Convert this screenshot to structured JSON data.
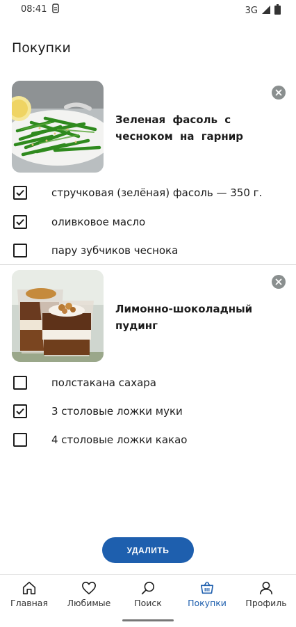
{
  "status": {
    "time": "08:41",
    "network": "3G"
  },
  "page": {
    "title": "Покупки"
  },
  "recipes": [
    {
      "title": "Зеленая фасоль с чесноком на гарнир",
      "ingredients": [
        {
          "text": "стручковая (зелёная) фасоль — 350 г.",
          "checked": true
        },
        {
          "text": "оливковое масло",
          "checked": true
        },
        {
          "text": "пару зубчиков чеснока",
          "checked": false
        }
      ]
    },
    {
      "title": "Лимонно-шоколадный пудинг",
      "ingredients": [
        {
          "text": "полстакана сахара",
          "checked": false
        },
        {
          "text": "3 столовые ложки муки",
          "checked": true
        },
        {
          "text": "4 столовые ложки какао",
          "checked": false
        }
      ]
    }
  ],
  "actions": {
    "delete_label": "УДАЛИТЬ"
  },
  "nav": {
    "active": "Покупки",
    "items": [
      {
        "label": "Главная",
        "icon": "home-icon"
      },
      {
        "label": "Любимые",
        "icon": "heart-icon"
      },
      {
        "label": "Поиск",
        "icon": "search-icon"
      },
      {
        "label": "Покупки",
        "icon": "basket-icon"
      },
      {
        "label": "Профиль",
        "icon": "profile-icon"
      }
    ]
  },
  "colors": {
    "accent": "#1e5fae",
    "remove": "#8a8f8f"
  }
}
